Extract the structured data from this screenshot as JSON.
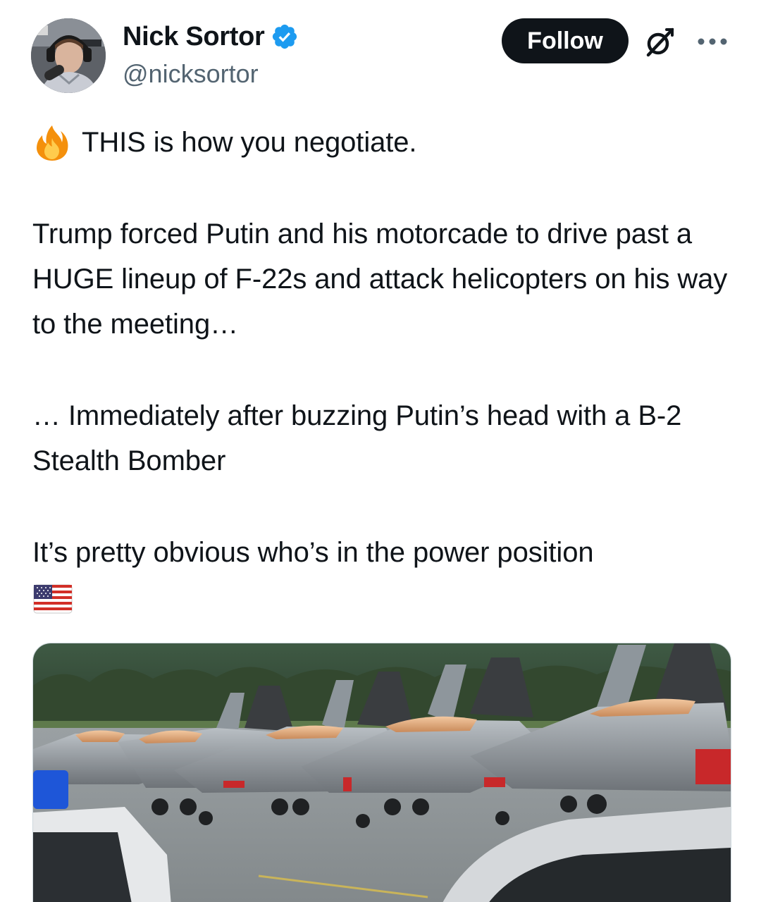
{
  "author": {
    "display_name": "Nick Sortor",
    "handle": "@nicksortor",
    "verified": true,
    "verified_color": "#1d9bf0"
  },
  "actions": {
    "follow_label": "Follow",
    "grok_icon": "grok-icon",
    "more_icon": "more-icon"
  },
  "tweet": {
    "line1_emoji": "fire-icon",
    "line1_text": "THIS is how you negotiate.",
    "paragraph2": "Trump forced Putin and his motorcade to drive past a HUGE lineup of F-22s and attack helicopters on his way to the meeting…",
    "paragraph3": "… Immediately after buzzing Putin’s head with a B-2 Stealth Bomber",
    "paragraph4": "It’s pretty obvious who’s in the power position",
    "trailing_emoji": "us-flag-icon"
  },
  "media": {
    "type": "video",
    "subject": "line of F-22 jets on tarmac with motorcade cars"
  },
  "colors": {
    "text": "#0f1419",
    "secondary": "#536471",
    "follow_bg": "#0f1419",
    "follow_text": "#ffffff"
  }
}
